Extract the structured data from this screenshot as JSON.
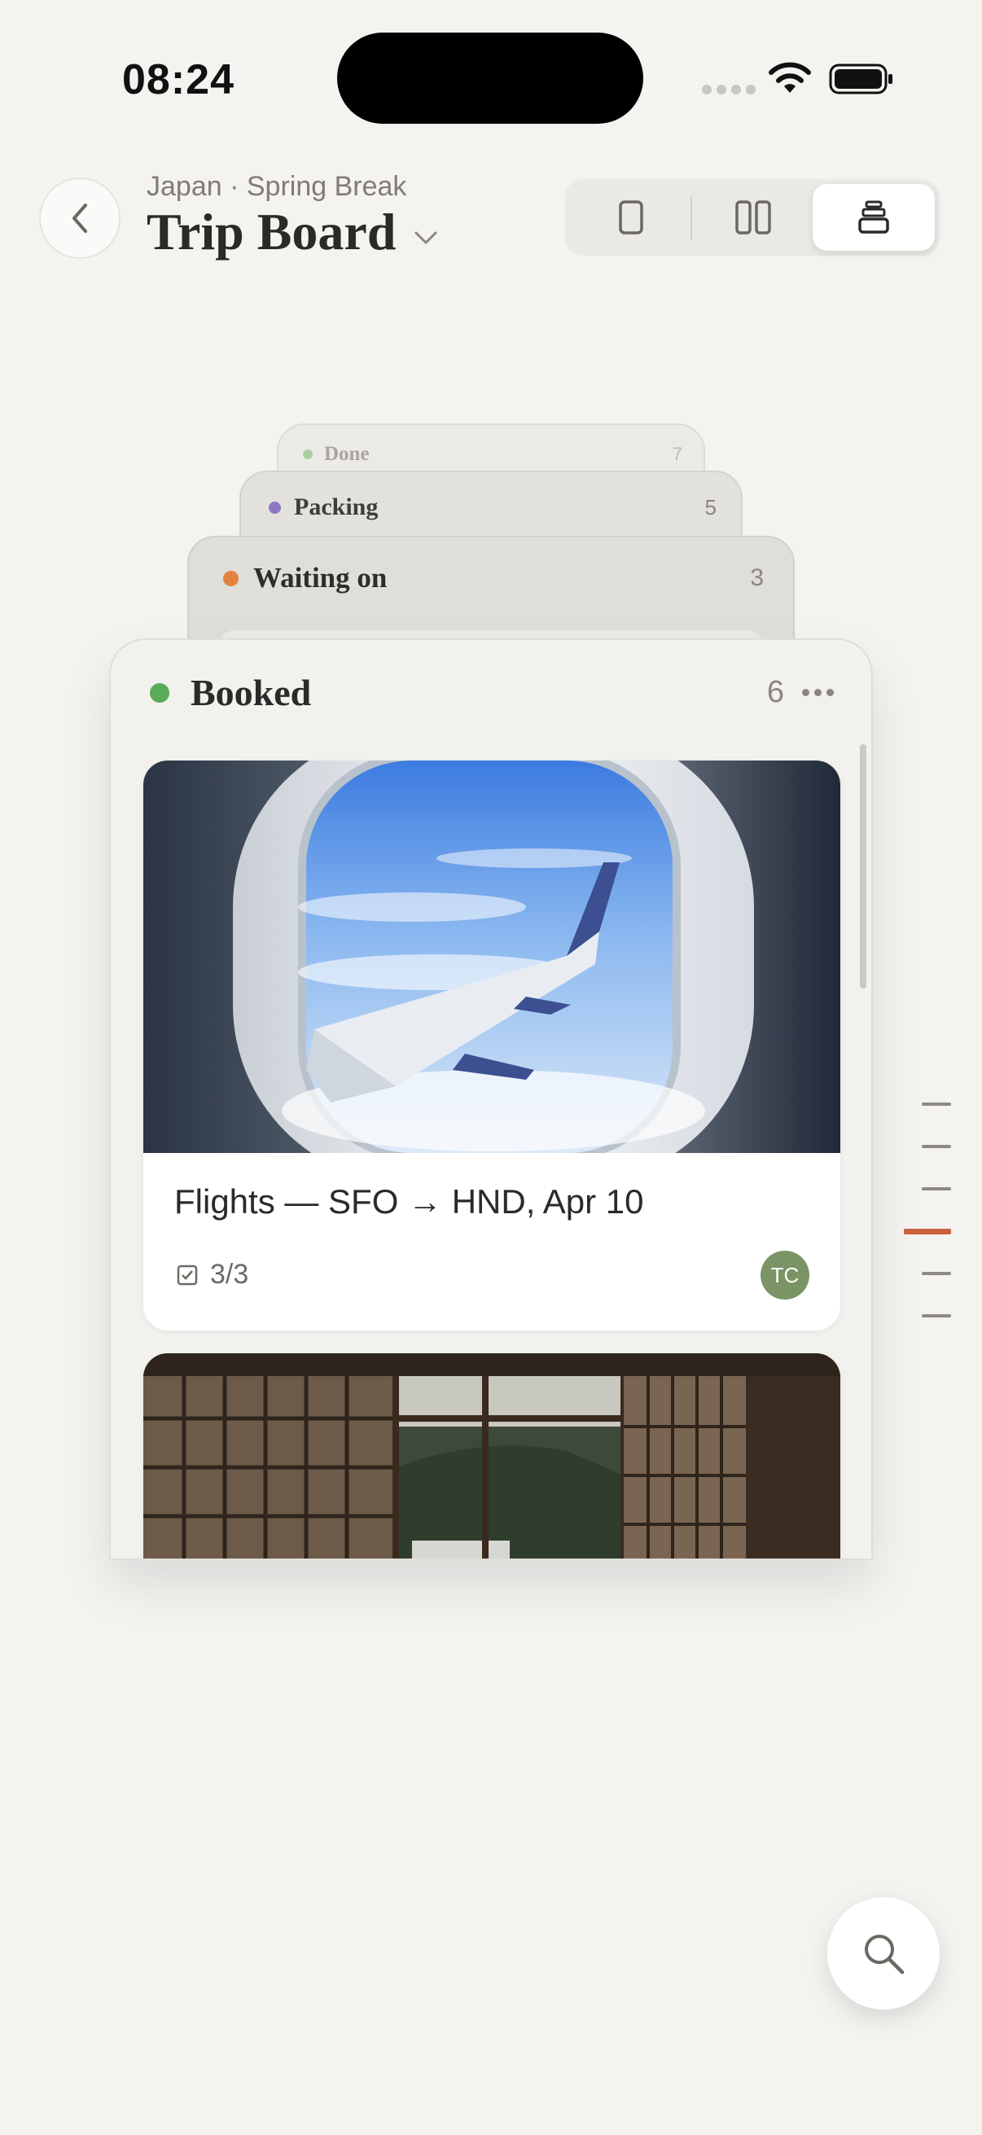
{
  "status_bar": {
    "time": "08:24"
  },
  "header": {
    "subtitle": "Japan · Spring Break",
    "title": "Trip Board"
  },
  "view_switcher": {
    "options": [
      "single-column-view",
      "two-column-view",
      "stacked-view"
    ],
    "selected": "stacked-view"
  },
  "stack": [
    {
      "label": "Done",
      "count": "7",
      "color": "#a8cfa3"
    },
    {
      "label": "Packing",
      "count": "5",
      "color": "#8e78c4"
    },
    {
      "label": "Waiting on",
      "count": "3",
      "color": "#e2823e"
    }
  ],
  "column": {
    "label": "Booked",
    "count": "6",
    "color": "#5aab55",
    "cards": [
      {
        "title": "Flights — SFO → HND, Apr 10",
        "checklist": "3/3",
        "assignee": "TC",
        "image": "airplane-window-wing"
      },
      {
        "title": "",
        "image": "ryokan-room-shoji"
      }
    ]
  },
  "scrubber": {
    "total": 6,
    "active_index": 3
  },
  "colors": {
    "accent": "#c9623d",
    "avatar": "#7a9465",
    "background": "#f4f3f0"
  }
}
